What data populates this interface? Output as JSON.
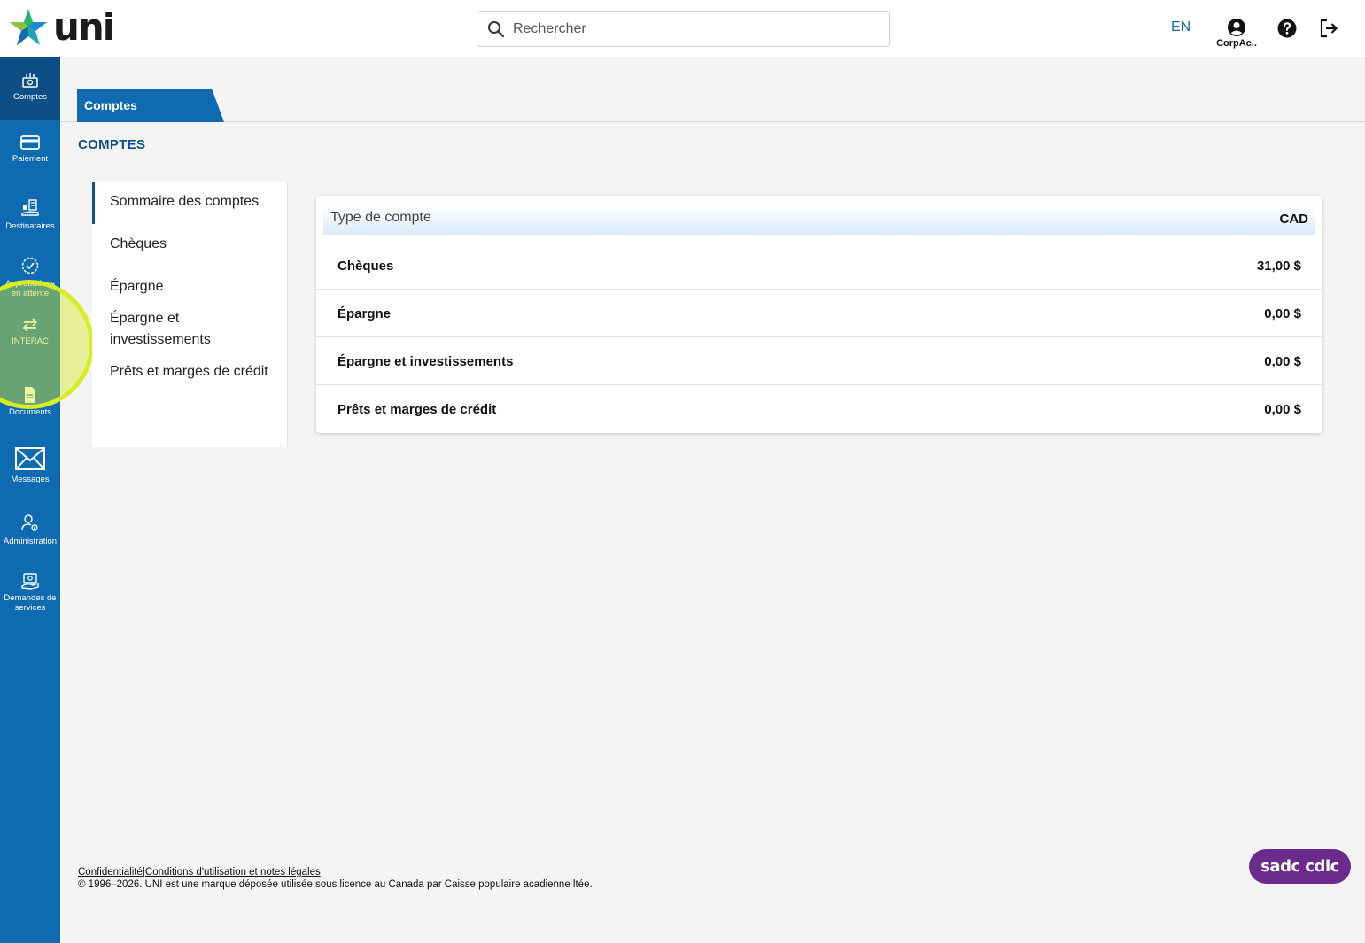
{
  "header": {
    "logo_text": "uni",
    "search_placeholder": "Rechercher",
    "language": "EN",
    "user_label": "CorpAc..",
    "brand_color": "#0e6ab1",
    "icons": [
      "search-icon",
      "user-icon",
      "help-icon",
      "logout-icon"
    ]
  },
  "sidebar": {
    "items": [
      {
        "label": "Comptes",
        "icon": "accounts-icon",
        "active": true
      },
      {
        "label": "Paiement",
        "icon": "card-icon"
      },
      {
        "label": "Destinataires",
        "icon": "recipients-icon"
      },
      {
        "label": "Approbations en attente",
        "icon": "approval-icon"
      },
      {
        "label": "INTERAC",
        "icon": "transfer-icon"
      },
      {
        "label": "Documents",
        "icon": "document-icon"
      },
      {
        "label": "Messages",
        "icon": "mail-icon"
      },
      {
        "label": "Administration",
        "icon": "admin-icon"
      },
      {
        "label": "Demandes de services",
        "icon": "service-request-icon"
      }
    ]
  },
  "tabs": [
    {
      "label": "Comptes"
    }
  ],
  "page_title": "COMPTES",
  "menu": {
    "items": [
      {
        "label": "Sommaire des comptes",
        "active": true
      },
      {
        "label": "Chèques"
      },
      {
        "label": "Épargne"
      },
      {
        "label": "Épargne et investissements"
      },
      {
        "label": "Prêts et marges de crédit"
      }
    ]
  },
  "summary": {
    "header_left": "Type de compte",
    "header_right": "CAD",
    "rows": [
      {
        "name": "Chèques",
        "amount": "31,00 $"
      },
      {
        "name": "Épargne",
        "amount": "0,00 $"
      },
      {
        "name": "Épargne et investissements",
        "amount": "0,00 $"
      },
      {
        "name": "Prêts et marges de crédit",
        "amount": "0,00 $"
      }
    ]
  },
  "footer": {
    "privacy": "Confidentialité",
    "separator": "|",
    "terms": "Conditions d'utilisation et notes légales",
    "copyright": "© 1996–2026. UNI est une marque déposée utilisée sous licence au Canada par Caisse populaire acadienne ltée.",
    "cdic_badge": "sadc cdic"
  }
}
